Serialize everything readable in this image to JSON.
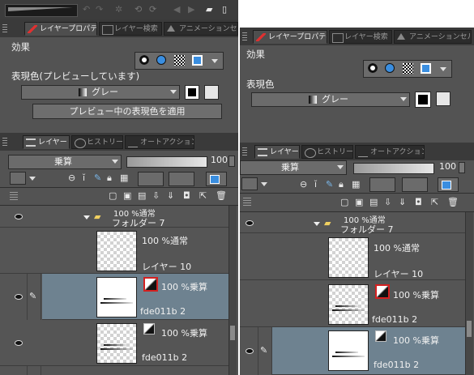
{
  "left_panel": {
    "tabs": [
      "レイヤープロパティ",
      "レイヤー検索",
      "アニメーションセル"
    ],
    "effect_label": "効果",
    "expression_color_label": "表現色(プレビューしています)",
    "expression_color_value": "グレー",
    "apply_button": "プレビュー中の表現色を適用",
    "layer_tabs": [
      "レイヤー",
      "ヒストリー",
      "オートアクション"
    ],
    "blend_mode": "乗算",
    "opacity": "100",
    "layers": [
      {
        "name": "フォルダー 7",
        "mode": "100 %通常",
        "type": "folder"
      },
      {
        "name": "レイヤー 10",
        "mode": "100 %通常"
      },
      {
        "name": "fde011b 2",
        "mode": "100 %乗算",
        "selected": true
      },
      {
        "name": "fde011b 2",
        "mode": "100 %乗算"
      }
    ]
  },
  "right_panel": {
    "tabs": [
      "レイヤープロパティ",
      "レイヤー検索",
      "アニメーションセル"
    ],
    "effect_label": "効果",
    "expression_color_label": "表現色",
    "expression_color_value": "グレー",
    "layer_tabs": [
      "レイヤー",
      "ヒストリー",
      "オートアクション"
    ],
    "blend_mode": "乗算",
    "opacity": "100",
    "layers": [
      {
        "name": "フォルダー 7",
        "mode": "100 %通常",
        "type": "folder"
      },
      {
        "name": "レイヤー 10",
        "mode": "100 %通常"
      },
      {
        "name": "fde011b 2",
        "mode": "100 %乗算"
      },
      {
        "name": "fde011b 2",
        "mode": "100 %乗算",
        "selected": true
      }
    ]
  },
  "colors": {
    "panel_bg": "#535353",
    "selected_row": "#6e8290",
    "mask_border": "#d32020"
  }
}
